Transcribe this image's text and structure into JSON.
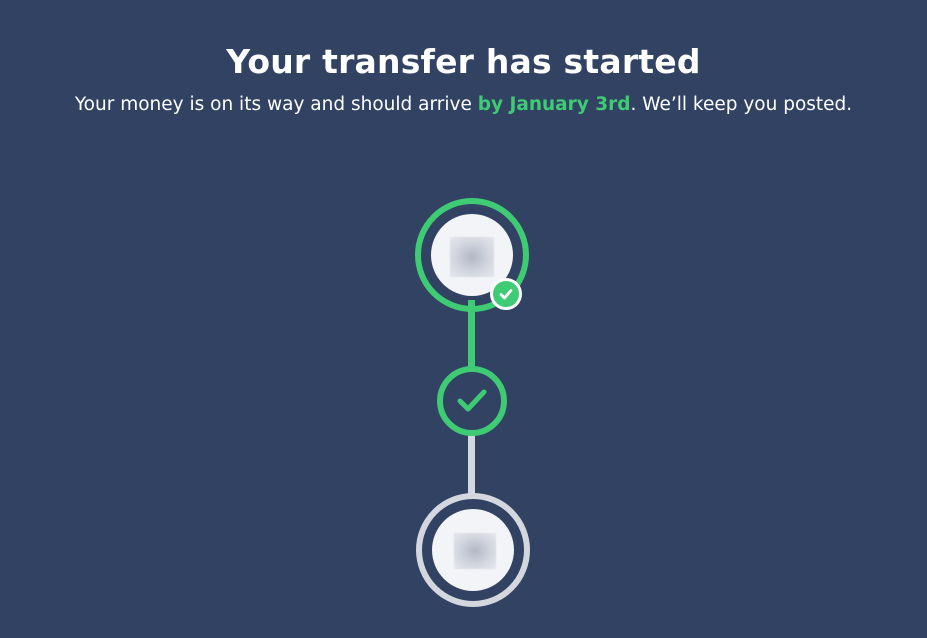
{
  "header": {
    "title": "Your transfer has started",
    "subtitle_before": "Your money is on its way and should arrive ",
    "subtitle_highlight": "by January 3rd",
    "subtitle_after": ". We’ll keep you posted."
  },
  "timeline": {
    "steps": [
      {
        "role": "sender",
        "status": "completed",
        "badge_icon": "check-icon"
      },
      {
        "role": "in-transit",
        "status": "completed",
        "icon": "check-icon"
      },
      {
        "role": "recipient",
        "status": "pending"
      }
    ]
  },
  "colors": {
    "background": "#314263",
    "accent_green": "#3ecb73",
    "pending_gray": "#d4d7de",
    "text": "#ffffff"
  }
}
